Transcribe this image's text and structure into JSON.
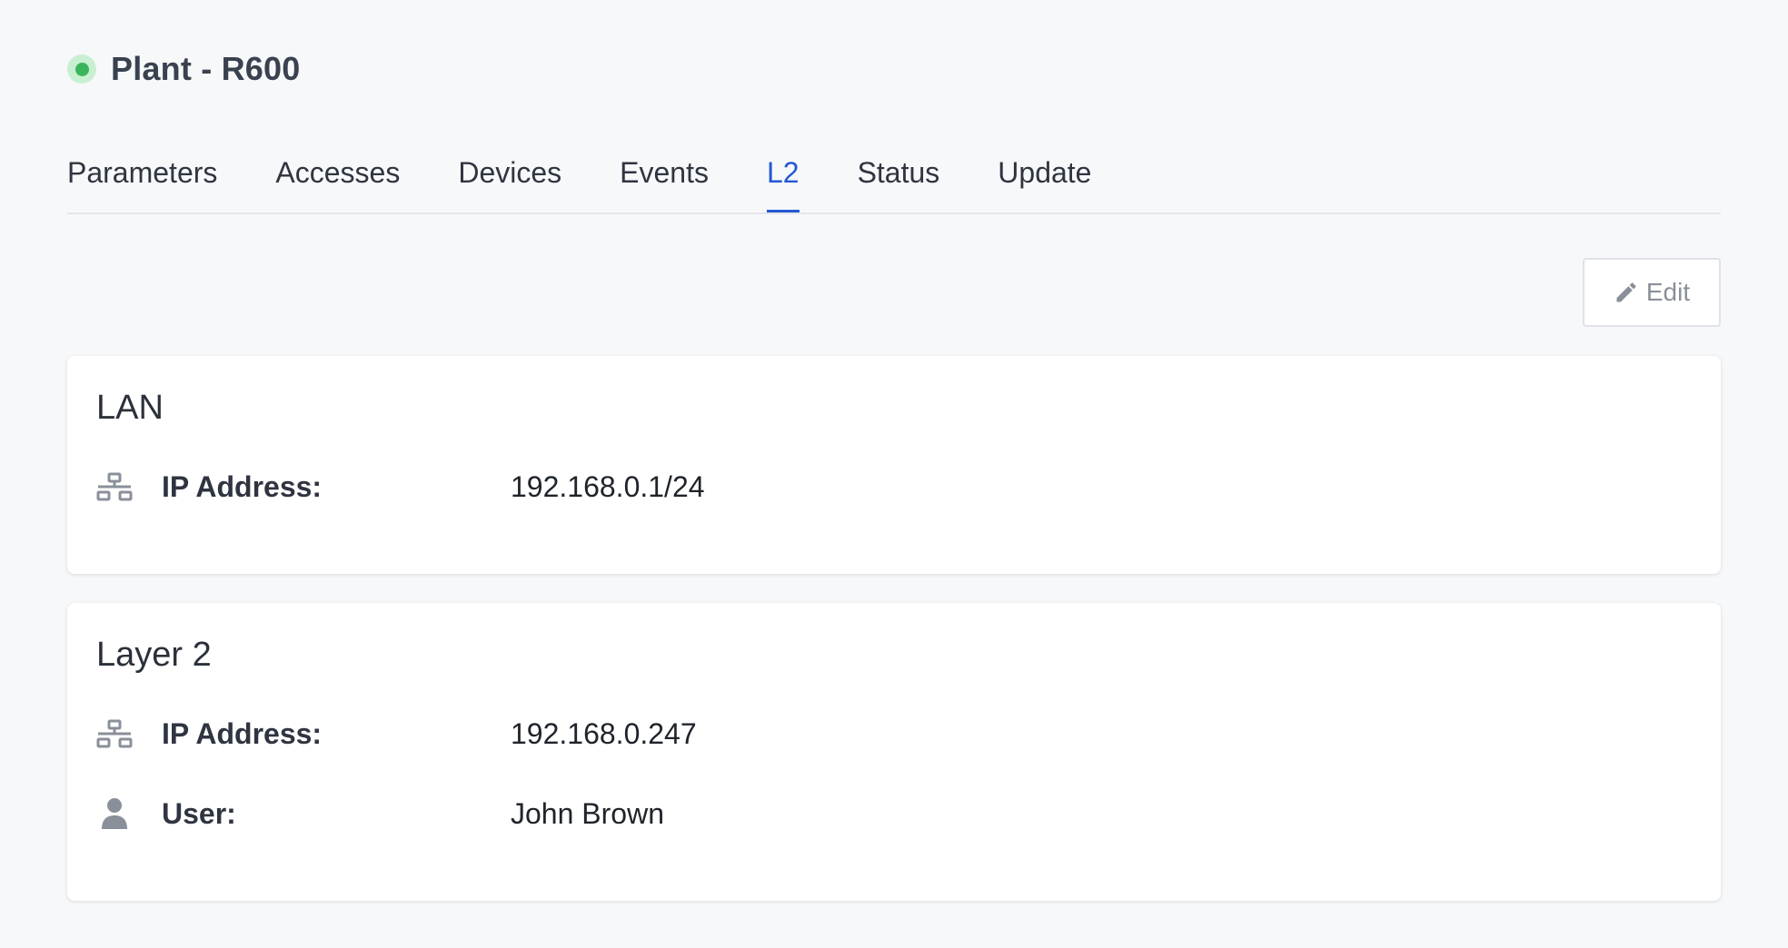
{
  "header": {
    "title": "Plant - R600",
    "status_color": "#3bb55c"
  },
  "tabs": [
    {
      "label": "Parameters",
      "active": false
    },
    {
      "label": "Accesses",
      "active": false
    },
    {
      "label": "Devices",
      "active": false
    },
    {
      "label": "Events",
      "active": false
    },
    {
      "label": "L2",
      "active": true
    },
    {
      "label": "Status",
      "active": false
    },
    {
      "label": "Update",
      "active": false
    }
  ],
  "toolbar": {
    "edit_label": "Edit",
    "edit_icon": "pencil-icon"
  },
  "lan": {
    "title": "LAN",
    "rows": [
      {
        "icon": "network-icon",
        "label": "IP Address:",
        "value": "192.168.0.1/24"
      }
    ]
  },
  "layer2": {
    "title": "Layer 2",
    "rows": [
      {
        "icon": "network-icon",
        "label": "IP Address:",
        "value": "192.168.0.247"
      },
      {
        "icon": "user-icon",
        "label": "User:",
        "value": "John Brown"
      }
    ]
  },
  "colors": {
    "accent": "#2459d3",
    "status_green": "#3bb55c",
    "icon_gray": "#8a909a"
  }
}
